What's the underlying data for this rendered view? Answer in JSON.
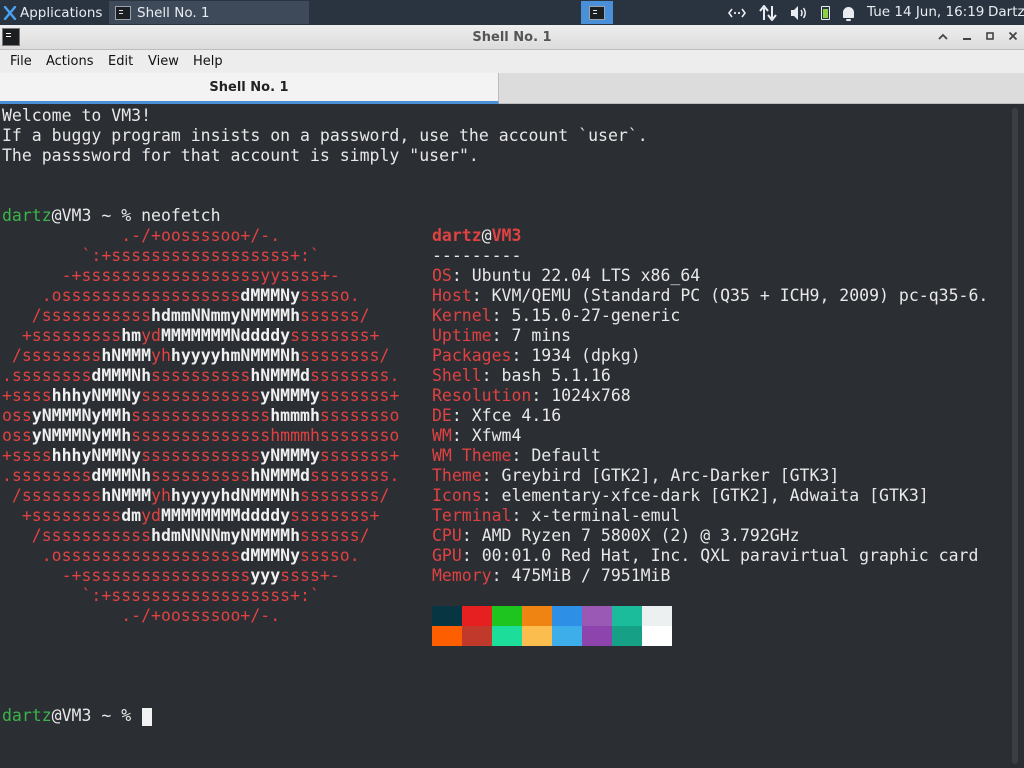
{
  "panel": {
    "applications_label": "Applications",
    "task_label": "Shell No. 1",
    "clock": "Tue 14 Jun, 16:19",
    "user": "Dartz",
    "tray_icons": [
      "network-icon",
      "transfer-icon",
      "volume-icon",
      "battery-icon",
      "notification-bell-icon"
    ]
  },
  "window": {
    "title": "Shell No. 1",
    "menu": [
      "File",
      "Actions",
      "Edit",
      "View",
      "Help"
    ],
    "tab_label": "Shell No. 1"
  },
  "terminal": {
    "welcome": [
      "Welcome to VM3!",
      "If a buggy program insists on a password, use the account `user`.",
      "The passsword for that account is simply \"user\"."
    ],
    "prompt_user": "dartz",
    "prompt_host": "@VM3 ~ % ",
    "command": "neofetch",
    "ascii_logo": [
      [
        [
          "r",
          "            .-/+oossssoo+/-."
        ]
      ],
      [
        [
          "r",
          "        `:+ssssssssssssssssss+:`"
        ]
      ],
      [
        [
          "r",
          "      -+ssssssssssssssssssyyssss+-"
        ]
      ],
      [
        [
          "r",
          "    .ossssssssssssssssss"
        ],
        [
          "w",
          "dMMMNy"
        ],
        [
          "r",
          "sssso."
        ]
      ],
      [
        [
          "r",
          "   /sssssssssss"
        ],
        [
          "w",
          "hdmmNNmmyNMMMMh"
        ],
        [
          "r",
          "ssssss/"
        ]
      ],
      [
        [
          "r",
          "  +sssssssss"
        ],
        [
          "w",
          "hm"
        ],
        [
          "r",
          "yd"
        ],
        [
          "w",
          "MMMMMMMNddddy"
        ],
        [
          "r",
          "ssssssss+"
        ]
      ],
      [
        [
          "r",
          " /ssssssss"
        ],
        [
          "w",
          "hNMMM"
        ],
        [
          "r",
          "yh"
        ],
        [
          "w",
          "hyyyyhmNMMMNh"
        ],
        [
          "r",
          "ssssssss/"
        ]
      ],
      [
        [
          "r",
          ".ssssssss"
        ],
        [
          "w",
          "dMMMNh"
        ],
        [
          "r",
          "ssssssssss"
        ],
        [
          "w",
          "hNMMMd"
        ],
        [
          "r",
          "ssssssss."
        ]
      ],
      [
        [
          "r",
          "+ssss"
        ],
        [
          "w",
          "hhhyNMMNy"
        ],
        [
          "r",
          "ssssssssssss"
        ],
        [
          "w",
          "yNMMMy"
        ],
        [
          "r",
          "sssssss+"
        ]
      ],
      [
        [
          "r",
          "oss"
        ],
        [
          "w",
          "yNMMMNyMMh"
        ],
        [
          "r",
          "ssssssssssssss"
        ],
        [
          "w",
          "hmmmh"
        ],
        [
          "r",
          "ssssssso"
        ]
      ],
      [
        [
          "r",
          "oss"
        ],
        [
          "w",
          "yNMMMNyMMh"
        ],
        [
          "r",
          "sssssssssssssshmmmhssssssso"
        ]
      ],
      [
        [
          "r",
          "+ssss"
        ],
        [
          "w",
          "hhhyNMMNy"
        ],
        [
          "r",
          "ssssssssssss"
        ],
        [
          "w",
          "yNMMMy"
        ],
        [
          "r",
          "sssssss+"
        ]
      ],
      [
        [
          "r",
          ".ssssssss"
        ],
        [
          "w",
          "dMMMNh"
        ],
        [
          "r",
          "ssssssssss"
        ],
        [
          "w",
          "hNMMMd"
        ],
        [
          "r",
          "ssssssss."
        ]
      ],
      [
        [
          "r",
          " /ssssssss"
        ],
        [
          "w",
          "hNMMM"
        ],
        [
          "r",
          "yh"
        ],
        [
          "w",
          "hyyyyhdNMMMNh"
        ],
        [
          "r",
          "ssssssss/"
        ]
      ],
      [
        [
          "r",
          "  +sssssssss"
        ],
        [
          "w",
          "dm"
        ],
        [
          "r",
          "yd"
        ],
        [
          "w",
          "MMMMMMMMddddy"
        ],
        [
          "r",
          "ssssssss+"
        ]
      ],
      [
        [
          "r",
          "   /sssssssssss"
        ],
        [
          "w",
          "hdmNNNNmyNMMMMh"
        ],
        [
          "r",
          "ssssss/"
        ]
      ],
      [
        [
          "r",
          "    .ossssssssssssssssss"
        ],
        [
          "w",
          "dMMMNy"
        ],
        [
          "r",
          "sssso."
        ]
      ],
      [
        [
          "r",
          "      -+sssssssssssssssss"
        ],
        [
          "w",
          "yyy"
        ],
        [
          "r",
          "ssss+-"
        ]
      ],
      [
        [
          "r",
          "        `:+ssssssssssssssssss+:`"
        ]
      ],
      [
        [
          "r",
          "            .-/+oossssoo+/-."
        ]
      ]
    ],
    "info_user": "dartz",
    "info_at": "@",
    "info_host": "VM3",
    "separator": "---------",
    "info": [
      {
        "key": "OS",
        "value": "Ubuntu 22.04 LTS x86_64"
      },
      {
        "key": "Host",
        "value": "KVM/QEMU (Standard PC (Q35 + ICH9, 2009) pc-q35-6."
      },
      {
        "key": "Kernel",
        "value": "5.15.0-27-generic"
      },
      {
        "key": "Uptime",
        "value": "7 mins"
      },
      {
        "key": "Packages",
        "value": "1934 (dpkg)"
      },
      {
        "key": "Shell",
        "value": "bash 5.1.16"
      },
      {
        "key": "Resolution",
        "value": "1024x768"
      },
      {
        "key": "DE",
        "value": "Xfce 4.16"
      },
      {
        "key": "WM",
        "value": "Xfwm4"
      },
      {
        "key": "WM Theme",
        "value": "Default"
      },
      {
        "key": "Theme",
        "value": "Greybird [GTK2], Arc-Darker [GTK3]"
      },
      {
        "key": "Icons",
        "value": "elementary-xfce-dark [GTK2], Adwaita [GTK3]"
      },
      {
        "key": "Terminal",
        "value": "x-terminal-emul"
      },
      {
        "key": "CPU",
        "value": "AMD Ryzen 7 5800X (2) @ 3.792GHz"
      },
      {
        "key": "GPU",
        "value": "00:01.0 Red Hat, Inc. QXL paravirtual graphic card"
      },
      {
        "key": "Memory",
        "value": "475MiB / 7951MiB"
      }
    ],
    "palette_row1": [
      "#073642",
      "#e62020",
      "#1ec51e",
      "#ef8412",
      "#2d8fe6",
      "#9b59b6",
      "#1abc9c",
      "#ecf0f1"
    ],
    "palette_row2": [
      "#fd5f00",
      "#c0392b",
      "#1ddd9a",
      "#fbbd4d",
      "#3daee9",
      "#8e44ad",
      "#16a085",
      "#ffffff"
    ],
    "colors": {
      "user": "#3bb44a",
      "accent": "#e04242",
      "text": "#e8e8e8",
      "background": "#2b2e33"
    }
  }
}
